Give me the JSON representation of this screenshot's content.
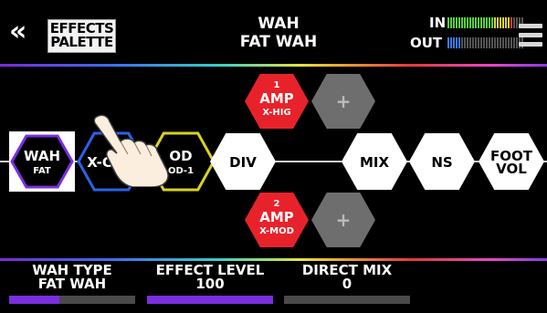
{
  "header": {
    "back_symbol": "«",
    "effects_palette_line1": "EFFECTS",
    "effects_palette_line2": "PALETTE",
    "title_line1": "WAH",
    "title_line2": "FAT WAH",
    "in_label": "IN",
    "out_label": "OUT"
  },
  "colors": {
    "accent_purple": "#7a2fe0",
    "amp_red": "#e8222a",
    "slot_gray": "#6e6e6e",
    "meter_green": "#59d13a",
    "meter_yellow": "#e2d43a",
    "meter_red": "#e23a3a",
    "meter_blue": "#3b7ae8"
  },
  "chain": {
    "blocks": [
      {
        "name": "WAH",
        "sub": "FAT",
        "outline": "#7a2fe0",
        "style": "outlined-white",
        "selected": true
      },
      {
        "name": "X-CMP",
        "sub": "",
        "outline": "#2b62e6",
        "style": "outlined-dark"
      },
      {
        "name": "OD",
        "sub": "OD-1",
        "outline": "#d8d21e",
        "style": "outlined-dark"
      },
      {
        "name": "DIV",
        "sub": "",
        "style": "white"
      },
      {
        "name": "MIX",
        "sub": "",
        "style": "white"
      },
      {
        "name": "NS",
        "sub": "",
        "style": "white"
      },
      {
        "name": "FOOT",
        "sub": "VOL",
        "style": "white"
      }
    ],
    "amp1": {
      "num": "1",
      "name": "AMP",
      "sub": "X-HIG"
    },
    "amp2": {
      "num": "2",
      "name": "AMP",
      "sub": "X-MOD"
    },
    "add_label": "+"
  },
  "params": [
    {
      "label": "WAH TYPE",
      "value": "FAT WAH",
      "fill": 0.4
    },
    {
      "label": "EFFECT LEVEL",
      "value": "100",
      "fill": 1.0
    },
    {
      "label": "DIRECT MIX",
      "value": "0",
      "fill": 0.0
    }
  ],
  "meters": {
    "in_level": 0.85,
    "out_level": 0.15
  }
}
